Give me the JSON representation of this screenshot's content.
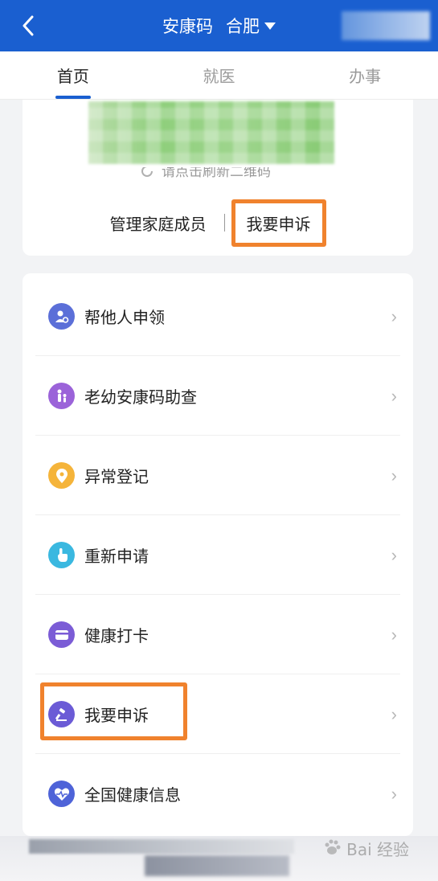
{
  "header": {
    "title": "安康码",
    "city": "合肥",
    "background": "#1a5fd0"
  },
  "tabs": [
    {
      "label": "首页",
      "active": true
    },
    {
      "label": "就医",
      "active": false
    },
    {
      "label": "办事",
      "active": false
    }
  ],
  "qr_card": {
    "refresh_hint": "请点击刷新二维码",
    "manage_family": "管理家庭成员",
    "appeal": "我要申诉"
  },
  "menu": [
    {
      "label": "帮他人申领",
      "icon": "user-add-icon",
      "color": "#5b6fd8"
    },
    {
      "label": "老幼安康码助查",
      "icon": "family-icon",
      "color": "#9b63d9"
    },
    {
      "label": "异常登记",
      "icon": "location-pin-icon",
      "color": "#f5b43a"
    },
    {
      "label": "重新申请",
      "icon": "tap-hand-icon",
      "color": "#3ab8e0"
    },
    {
      "label": "健康打卡",
      "icon": "wallet-icon",
      "color": "#7b5cd6"
    },
    {
      "label": "我要申诉",
      "icon": "gavel-icon",
      "color": "#6b5bd6"
    },
    {
      "label": "全国健康信息",
      "icon": "heart-pulse-icon",
      "color": "#4e63d8"
    }
  ],
  "watermark": {
    "text": "Bai 经验",
    "accent": "#f0822d"
  }
}
